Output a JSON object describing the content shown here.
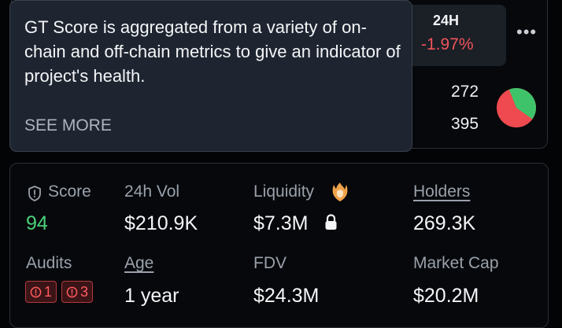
{
  "price_change": {
    "label": "24H",
    "value": "-1.97%"
  },
  "more_menu": {
    "glyph": "•••"
  },
  "sentiment": {
    "up_votes": "272",
    "down_votes": "395",
    "colors": {
      "up": "#3fc36a",
      "down": "#ef4a4f"
    }
  },
  "tooltip": {
    "text": "GT Score is aggregated from a variety of on-chain and off-chain metrics to give an indicator of project's health.",
    "see_more": "SEE MORE"
  },
  "stats": {
    "score": {
      "label": "Score",
      "value": "94",
      "icon": "shield-icon"
    },
    "vol24h": {
      "label": "24h Vol",
      "value": "$210.9K"
    },
    "liquidity": {
      "label": "Liquidity",
      "value": "$7.3M",
      "icon": "fire-shield-icon",
      "lock_icon": "lock-icon"
    },
    "holders": {
      "label": "Holders",
      "value": "269.3K"
    },
    "audits": {
      "label": "Audits",
      "badges": [
        {
          "icon": "alert-circle-icon",
          "count": "1"
        },
        {
          "icon": "alert-circle-icon",
          "count": "3"
        }
      ]
    },
    "age": {
      "label": "Age",
      "value": "1 year"
    },
    "fdv": {
      "label": "FDV",
      "value": "$24.3M"
    },
    "market_cap": {
      "label": "Market Cap",
      "value": "$20.2M"
    }
  },
  "colors": {
    "accent_green": "#4bd27a",
    "negative_red": "#f0545b",
    "tooltip_bg": "#1e2531",
    "card_border": "#2b2f36"
  }
}
